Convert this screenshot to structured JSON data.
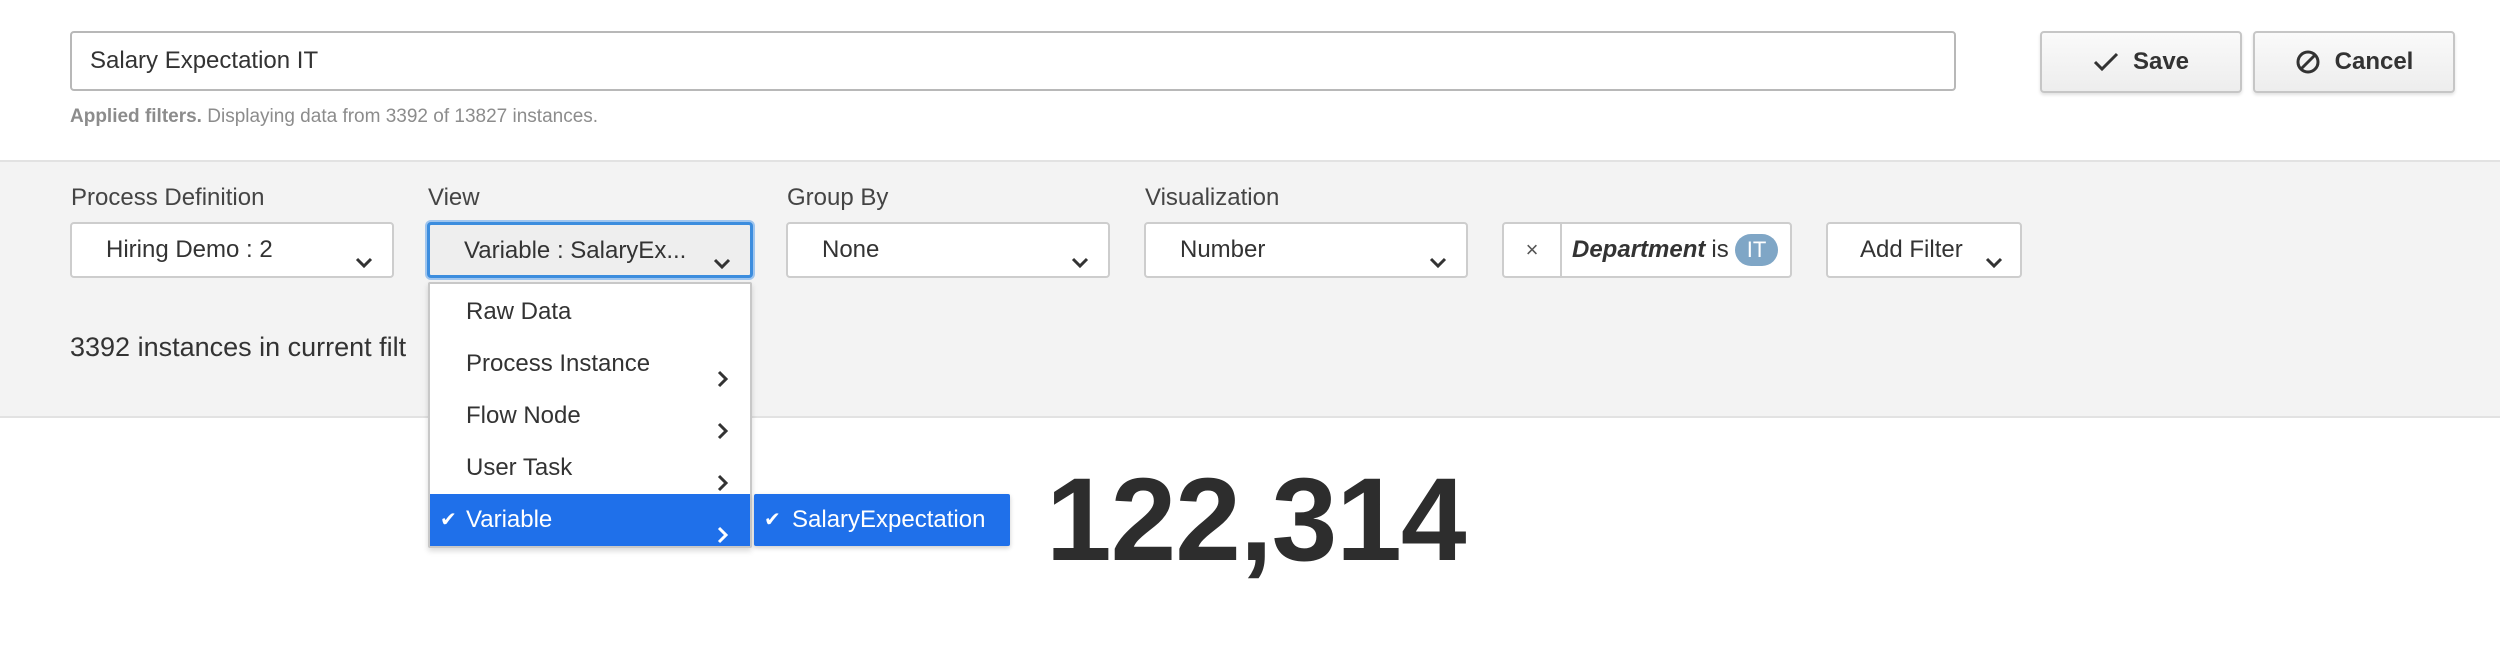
{
  "header": {
    "report_name": "Salary Expectation IT",
    "save_label": "Save",
    "cancel_label": "Cancel",
    "applied_filters_label": "Applied filters.",
    "applied_filters_text": "Displaying data from 3392 of 13827 instances."
  },
  "controls": {
    "process_definition": {
      "label": "Process Definition",
      "value": "Hiring Demo : 2"
    },
    "view": {
      "label": "View",
      "value": "Variable : SalaryEx..."
    },
    "group_by": {
      "label": "Group By",
      "value": "None"
    },
    "visualization": {
      "label": "Visualization",
      "value": "Number"
    },
    "filter": {
      "remove": "×",
      "variable": "Department",
      "operator": "is",
      "value": "IT"
    },
    "add_filter_label": "Add Filter",
    "instances_text": "3392 instances in current filt"
  },
  "view_menu": {
    "items": [
      {
        "label": "Raw Data",
        "has_submenu": false,
        "selected": false
      },
      {
        "label": "Process Instance",
        "has_submenu": true,
        "selected": false
      },
      {
        "label": "Flow Node",
        "has_submenu": true,
        "selected": false
      },
      {
        "label": "User Task",
        "has_submenu": true,
        "selected": false
      },
      {
        "label": "Variable",
        "has_submenu": true,
        "selected": true
      }
    ],
    "submenu": {
      "label": "SalaryExpectation",
      "selected": true
    }
  },
  "result": {
    "value": "122,314"
  },
  "colors": {
    "accent": "#1f70ea",
    "focus": "#3c8dde",
    "badge": "#7fa6c6",
    "panel": "#f3f3f3"
  }
}
